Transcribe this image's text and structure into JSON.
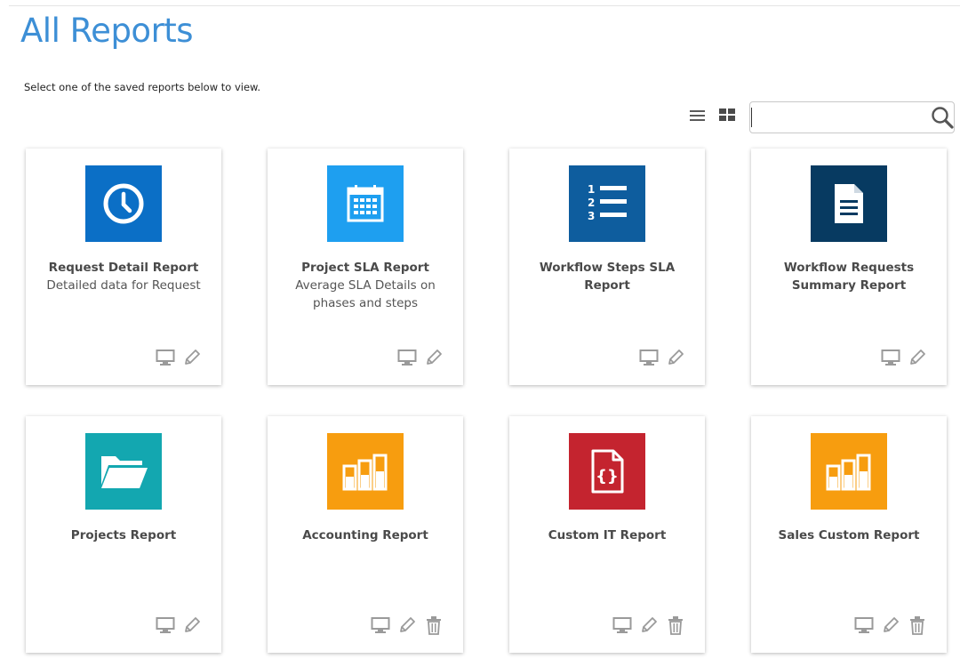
{
  "page": {
    "title": "All Reports",
    "subtitle": "Select one of the saved reports below to view."
  },
  "toolbar": {
    "list_view_icon": "list-icon",
    "grid_view_icon": "grid-icon",
    "search_value": "",
    "search_placeholder": "",
    "search_icon": "search-icon"
  },
  "colors": {
    "title_blue": "#3d8fd6",
    "tile_blue": "#0b6fc6",
    "tile_sky": "#1e9ff0",
    "tile_navy_blue": "#0e5d9e",
    "tile_dark_navy": "#073a61",
    "tile_teal": "#13a7b0",
    "tile_orange": "#f79d0f",
    "tile_red": "#c4242f",
    "action_icon_gray": "#9a9a9a"
  },
  "reports": [
    {
      "title": "Request Detail Report",
      "description": "Detailed data for Request",
      "icon": "clock-icon",
      "color": "#0b6fc6",
      "actions": [
        "view",
        "edit"
      ]
    },
    {
      "title": "Project SLA Report",
      "description": "Average SLA Details on phases and steps",
      "icon": "calendar-icon",
      "color": "#1e9ff0",
      "actions": [
        "view",
        "edit"
      ]
    },
    {
      "title": "Workflow Steps SLA Report",
      "description": "",
      "icon": "numbered-list-icon",
      "color": "#0e5d9e",
      "actions": [
        "view",
        "edit"
      ]
    },
    {
      "title": "Workflow Requests Summary Report",
      "description": "",
      "icon": "document-icon",
      "color": "#073a61",
      "actions": [
        "view",
        "edit"
      ]
    },
    {
      "title": "Projects Report",
      "description": "",
      "icon": "folder-icon",
      "color": "#13a7b0",
      "actions": [
        "view",
        "edit"
      ]
    },
    {
      "title": "Accounting Report",
      "description": "",
      "icon": "bar-chart-icon",
      "color": "#f79d0f",
      "actions": [
        "view",
        "edit",
        "delete"
      ]
    },
    {
      "title": "Custom IT Report",
      "description": "",
      "icon": "code-file-icon",
      "color": "#c4242f",
      "actions": [
        "view",
        "edit",
        "delete"
      ]
    },
    {
      "title": "Sales Custom Report",
      "description": "",
      "icon": "bar-chart-icon",
      "color": "#f79d0f",
      "actions": [
        "view",
        "edit",
        "delete"
      ]
    }
  ]
}
